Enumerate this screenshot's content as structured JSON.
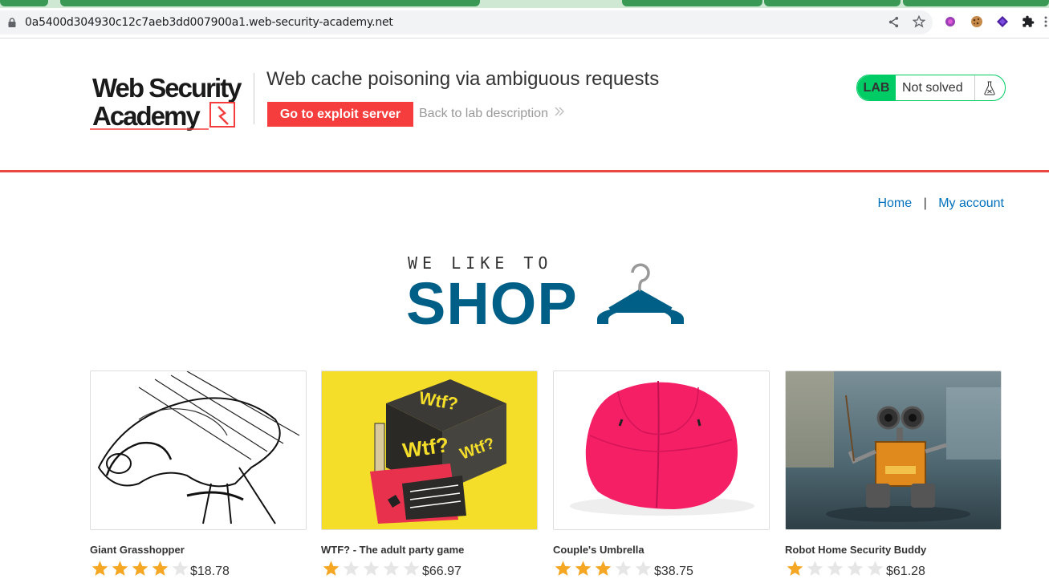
{
  "browser": {
    "url": "0a5400d304930c12c7aeb3dd007900a1.web-security-academy.net",
    "toolbar_icons": [
      "share-icon",
      "star-icon",
      "extension-purple-icon",
      "cookie-icon",
      "extension-diamond-icon",
      "puzzle-icon",
      "menu-icon"
    ]
  },
  "header": {
    "logo_text_line1": "Web Security",
    "logo_text_line2": "Academy",
    "lab_title": "Web cache poisoning via ambiguous requests",
    "exploit_button": "Go to exploit server",
    "back_link": "Back to lab description",
    "lab_badge": "LAB",
    "lab_status": "Not solved",
    "accent_color": "#f53d3d",
    "status_color": "#00cc66"
  },
  "nav": {
    "home": "Home",
    "separator": "|",
    "my_account": "My account"
  },
  "banner": {
    "tagline": "WE LIKE TO",
    "title": "SHOP"
  },
  "products": [
    {
      "name": "Giant Grasshopper",
      "rating": 4,
      "price": "$18.78"
    },
    {
      "name": "WTF? - The adult party game",
      "rating": 1,
      "price": "$66.97"
    },
    {
      "name": "Couple's Umbrella",
      "rating": 3,
      "price": "$38.75"
    },
    {
      "name": "Robot Home Security Buddy",
      "rating": 1,
      "price": "$61.28"
    }
  ]
}
